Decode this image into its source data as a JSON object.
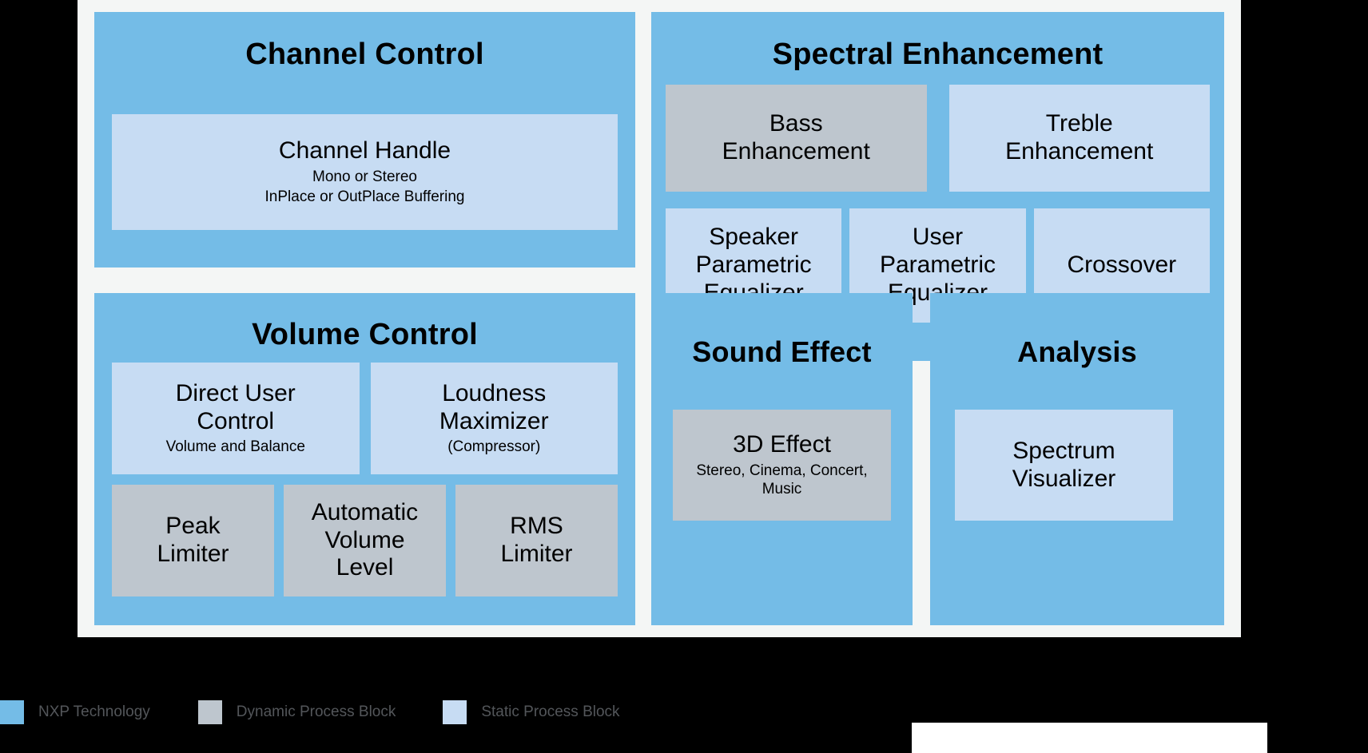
{
  "colors": {
    "page_background": "#000000",
    "canvas_background": "#F4F6F5",
    "nxp_blue": "#74BCE7",
    "static_block": "#C7DCF3",
    "dynamic_block": "#BEC6CE",
    "text": "#000000",
    "legend_text": "#53565A",
    "bottom_bar": "#FFFFFF"
  },
  "panels": {
    "channel_control": {
      "title": "Channel Control",
      "blocks": [
        {
          "title": "Channel Handle",
          "subtitles": [
            "Mono or Stereo",
            "InPlace or OutPlace Buffering"
          ],
          "kind": "static"
        }
      ]
    },
    "volume_control": {
      "title": "Volume Control",
      "row1": [
        {
          "title": "Direct User Control",
          "subtitles": [
            "Volume and Balance"
          ],
          "kind": "static"
        },
        {
          "title": "Loudness Maximizer",
          "subtitles": [
            "(Compressor)"
          ],
          "kind": "static"
        }
      ],
      "row2": [
        {
          "title": "Peak Limiter",
          "subtitles": [],
          "kind": "dynamic"
        },
        {
          "title": "Automatic Volume Level",
          "subtitles": [],
          "kind": "dynamic"
        },
        {
          "title": "RMS Limiter",
          "subtitles": [],
          "kind": "dynamic"
        }
      ]
    },
    "spectral_enhancement": {
      "title": "Spectral Enhancement",
      "row1": [
        {
          "title": "Bass Enhancement",
          "subtitles": [],
          "kind": "dynamic"
        },
        {
          "title": "Treble Enhancement",
          "subtitles": [],
          "kind": "static"
        }
      ],
      "row2": [
        {
          "title": "Speaker Parametric Equalizer",
          "subtitles": [],
          "kind": "static"
        },
        {
          "title": "User Parametric Equalizer",
          "subtitles": [],
          "kind": "static"
        },
        {
          "title": "Crossover",
          "subtitles": [],
          "kind": "static"
        }
      ]
    },
    "sound_effect": {
      "title": "Sound Effect",
      "blocks": [
        {
          "title": "3D Effect",
          "subtitles": [
            "Stereo, Cinema, Concert, Music"
          ],
          "kind": "dynamic"
        }
      ]
    },
    "analysis": {
      "title": "Analysis",
      "blocks": [
        {
          "title": "Spectrum Visualizer",
          "subtitles": [],
          "kind": "static"
        }
      ]
    }
  },
  "legend": {
    "items": [
      {
        "label": "NXP Technology",
        "swatch": "#74BCE7"
      },
      {
        "label": "Dynamic Process Block",
        "swatch": "#BEC6CE"
      },
      {
        "label": "Static Process Block",
        "swatch": "#C7DCF3"
      }
    ]
  }
}
